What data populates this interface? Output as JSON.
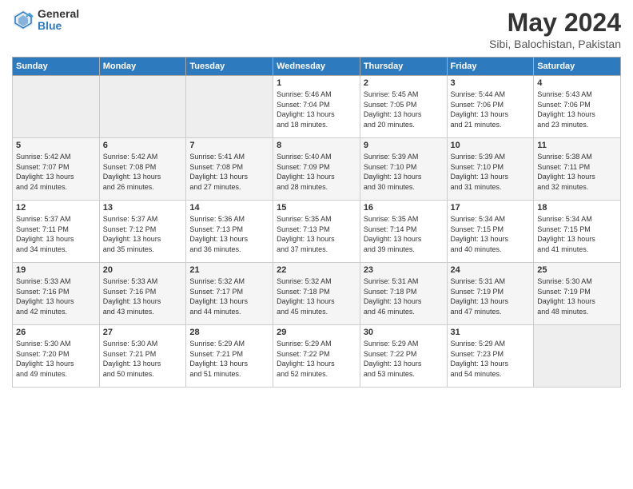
{
  "logo": {
    "general": "General",
    "blue": "Blue"
  },
  "title": "May 2024",
  "subtitle": "Sibi, Balochistan, Pakistan",
  "days_of_week": [
    "Sunday",
    "Monday",
    "Tuesday",
    "Wednesday",
    "Thursday",
    "Friday",
    "Saturday"
  ],
  "weeks": [
    [
      {
        "day": "",
        "info": ""
      },
      {
        "day": "",
        "info": ""
      },
      {
        "day": "",
        "info": ""
      },
      {
        "day": "1",
        "info": "Sunrise: 5:46 AM\nSunset: 7:04 PM\nDaylight: 13 hours\nand 18 minutes."
      },
      {
        "day": "2",
        "info": "Sunrise: 5:45 AM\nSunset: 7:05 PM\nDaylight: 13 hours\nand 20 minutes."
      },
      {
        "day": "3",
        "info": "Sunrise: 5:44 AM\nSunset: 7:06 PM\nDaylight: 13 hours\nand 21 minutes."
      },
      {
        "day": "4",
        "info": "Sunrise: 5:43 AM\nSunset: 7:06 PM\nDaylight: 13 hours\nand 23 minutes."
      }
    ],
    [
      {
        "day": "5",
        "info": "Sunrise: 5:42 AM\nSunset: 7:07 PM\nDaylight: 13 hours\nand 24 minutes."
      },
      {
        "day": "6",
        "info": "Sunrise: 5:42 AM\nSunset: 7:08 PM\nDaylight: 13 hours\nand 26 minutes."
      },
      {
        "day": "7",
        "info": "Sunrise: 5:41 AM\nSunset: 7:08 PM\nDaylight: 13 hours\nand 27 minutes."
      },
      {
        "day": "8",
        "info": "Sunrise: 5:40 AM\nSunset: 7:09 PM\nDaylight: 13 hours\nand 28 minutes."
      },
      {
        "day": "9",
        "info": "Sunrise: 5:39 AM\nSunset: 7:10 PM\nDaylight: 13 hours\nand 30 minutes."
      },
      {
        "day": "10",
        "info": "Sunrise: 5:39 AM\nSunset: 7:10 PM\nDaylight: 13 hours\nand 31 minutes."
      },
      {
        "day": "11",
        "info": "Sunrise: 5:38 AM\nSunset: 7:11 PM\nDaylight: 13 hours\nand 32 minutes."
      }
    ],
    [
      {
        "day": "12",
        "info": "Sunrise: 5:37 AM\nSunset: 7:11 PM\nDaylight: 13 hours\nand 34 minutes."
      },
      {
        "day": "13",
        "info": "Sunrise: 5:37 AM\nSunset: 7:12 PM\nDaylight: 13 hours\nand 35 minutes."
      },
      {
        "day": "14",
        "info": "Sunrise: 5:36 AM\nSunset: 7:13 PM\nDaylight: 13 hours\nand 36 minutes."
      },
      {
        "day": "15",
        "info": "Sunrise: 5:35 AM\nSunset: 7:13 PM\nDaylight: 13 hours\nand 37 minutes."
      },
      {
        "day": "16",
        "info": "Sunrise: 5:35 AM\nSunset: 7:14 PM\nDaylight: 13 hours\nand 39 minutes."
      },
      {
        "day": "17",
        "info": "Sunrise: 5:34 AM\nSunset: 7:15 PM\nDaylight: 13 hours\nand 40 minutes."
      },
      {
        "day": "18",
        "info": "Sunrise: 5:34 AM\nSunset: 7:15 PM\nDaylight: 13 hours\nand 41 minutes."
      }
    ],
    [
      {
        "day": "19",
        "info": "Sunrise: 5:33 AM\nSunset: 7:16 PM\nDaylight: 13 hours\nand 42 minutes."
      },
      {
        "day": "20",
        "info": "Sunrise: 5:33 AM\nSunset: 7:16 PM\nDaylight: 13 hours\nand 43 minutes."
      },
      {
        "day": "21",
        "info": "Sunrise: 5:32 AM\nSunset: 7:17 PM\nDaylight: 13 hours\nand 44 minutes."
      },
      {
        "day": "22",
        "info": "Sunrise: 5:32 AM\nSunset: 7:18 PM\nDaylight: 13 hours\nand 45 minutes."
      },
      {
        "day": "23",
        "info": "Sunrise: 5:31 AM\nSunset: 7:18 PM\nDaylight: 13 hours\nand 46 minutes."
      },
      {
        "day": "24",
        "info": "Sunrise: 5:31 AM\nSunset: 7:19 PM\nDaylight: 13 hours\nand 47 minutes."
      },
      {
        "day": "25",
        "info": "Sunrise: 5:30 AM\nSunset: 7:19 PM\nDaylight: 13 hours\nand 48 minutes."
      }
    ],
    [
      {
        "day": "26",
        "info": "Sunrise: 5:30 AM\nSunset: 7:20 PM\nDaylight: 13 hours\nand 49 minutes."
      },
      {
        "day": "27",
        "info": "Sunrise: 5:30 AM\nSunset: 7:21 PM\nDaylight: 13 hours\nand 50 minutes."
      },
      {
        "day": "28",
        "info": "Sunrise: 5:29 AM\nSunset: 7:21 PM\nDaylight: 13 hours\nand 51 minutes."
      },
      {
        "day": "29",
        "info": "Sunrise: 5:29 AM\nSunset: 7:22 PM\nDaylight: 13 hours\nand 52 minutes."
      },
      {
        "day": "30",
        "info": "Sunrise: 5:29 AM\nSunset: 7:22 PM\nDaylight: 13 hours\nand 53 minutes."
      },
      {
        "day": "31",
        "info": "Sunrise: 5:29 AM\nSunset: 7:23 PM\nDaylight: 13 hours\nand 54 minutes."
      },
      {
        "day": "",
        "info": ""
      }
    ]
  ]
}
